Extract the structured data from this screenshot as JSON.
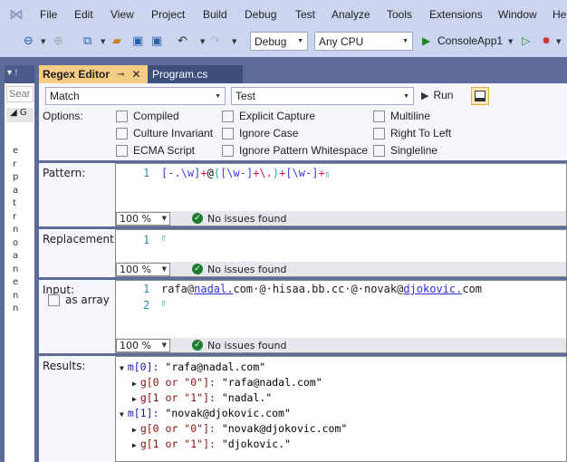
{
  "menu": [
    "File",
    "Edit",
    "View",
    "Project",
    "Build",
    "Debug",
    "Test",
    "Analyze",
    "Tools",
    "Extensions",
    "Window",
    "He"
  ],
  "toolbar": {
    "config": "Debug",
    "platform": "Any CPU",
    "start": "ConsoleApp1"
  },
  "left_panel": {
    "search_placeholder": "Sear",
    "letters": [
      "e",
      "r",
      "p",
      "a",
      "t",
      "r",
      "n",
      "o",
      "a",
      "n",
      "e",
      "n",
      "n"
    ]
  },
  "tabs": [
    {
      "label": "Regex Editor",
      "active": true
    },
    {
      "label": "Program.cs",
      "active": false
    }
  ],
  "controls": {
    "mode": "Match",
    "target": "Test",
    "run": "Run"
  },
  "options": {
    "label": "Options:",
    "items": [
      "Compiled",
      "Explicit Capture",
      "Multiline",
      "Culture Invariant",
      "Ignore Case",
      "Right To Left",
      "ECMA Script",
      "Ignore Pattern Whitespace",
      "Singleline"
    ]
  },
  "pattern": {
    "label": "Pattern:",
    "line": "1",
    "tokens": [
      [
        "[-.\\w]",
        "b"
      ],
      [
        "+",
        "r"
      ],
      [
        "@",
        "k"
      ],
      [
        "(",
        "t"
      ],
      [
        "[\\w-]",
        "b"
      ],
      [
        "+",
        "r"
      ],
      [
        "\\.",
        "r"
      ],
      [
        ")",
        "t"
      ],
      [
        "+",
        "r"
      ],
      [
        "[\\w-]",
        "b"
      ],
      [
        "+",
        "r"
      ]
    ],
    "zoom": "100 %",
    "status": "No issues found"
  },
  "replacement": {
    "label": "Replacement:",
    "line": "1",
    "zoom": "100 %",
    "status": "No issues found"
  },
  "input": {
    "label": "Input:",
    "as_array": "as array",
    "line1": "1",
    "line2": "2",
    "tokens": [
      [
        "rafa@",
        ""
      ],
      [
        "nadal.",
        "u"
      ],
      [
        "com·@·hisaa.bb.cc·@·novak@",
        ""
      ],
      [
        "djokovic.",
        "u"
      ],
      [
        "com",
        ""
      ]
    ],
    "zoom": "100 %",
    "status": "No issues found"
  },
  "results": {
    "label": "Results:",
    "items": [
      {
        "level": 0,
        "key": "m[0]",
        "value": "\"rafa@nadal.com\""
      },
      {
        "level": 1,
        "key": "g[0 or \"0\"]",
        "value": "\"rafa@nadal.com\""
      },
      {
        "level": 1,
        "key": "g[1 or \"1\"]",
        "value": "\"nadal.\""
      },
      {
        "level": 0,
        "key": "m[1]",
        "value": "\"novak@djokovic.com\""
      },
      {
        "level": 1,
        "key": "g[0 or \"0\"]",
        "value": "\"novak@djokovic.com\""
      },
      {
        "level": 1,
        "key": "g[1 or \"1\"]",
        "value": "\"djokovic.\""
      }
    ]
  }
}
